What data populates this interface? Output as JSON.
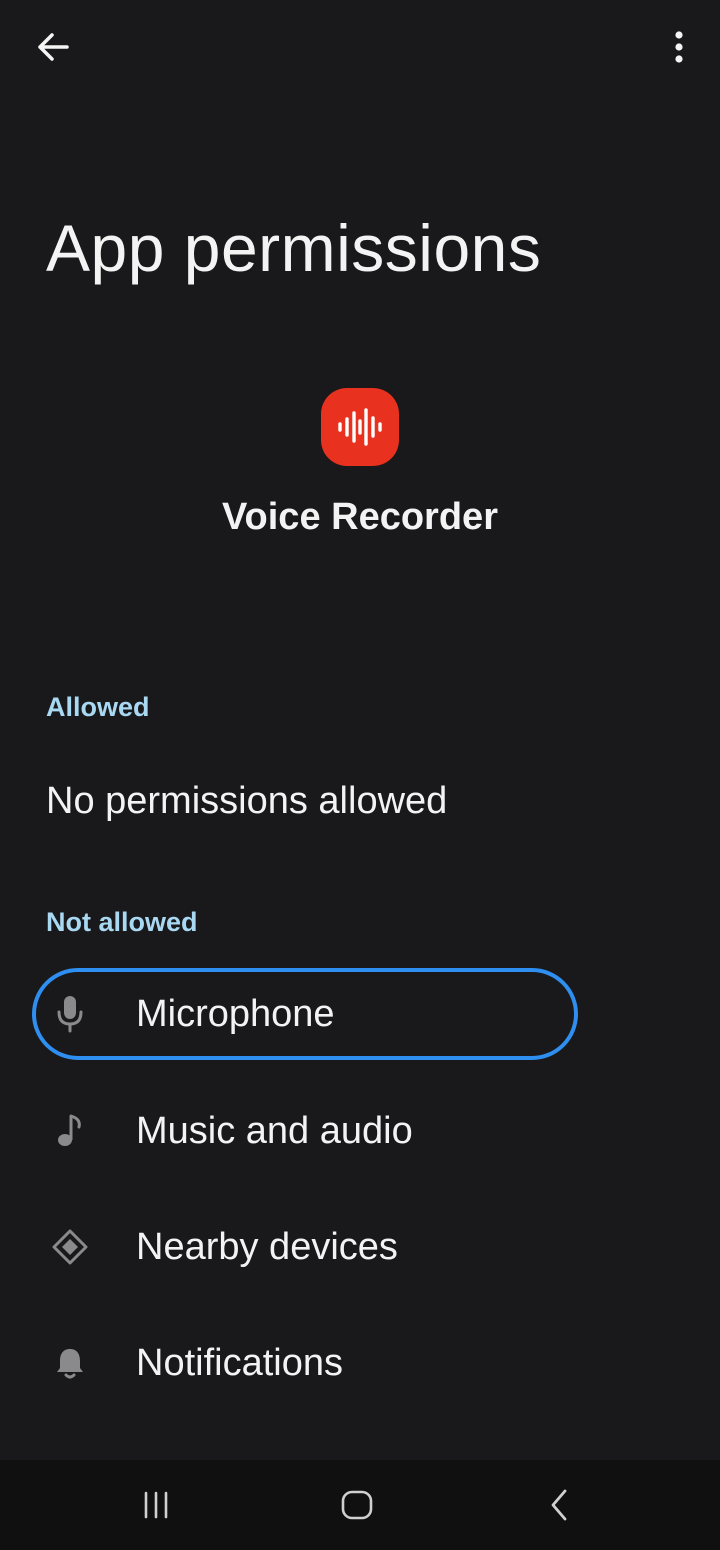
{
  "header": {
    "back_icon": "arrow-left-icon",
    "more_icon": "more-vert-icon"
  },
  "page": {
    "title": "App permissions"
  },
  "app": {
    "name": "Voice Recorder",
    "icon": "waveform-icon",
    "icon_color": "#e8321f"
  },
  "sections": {
    "allowed": {
      "header": "Allowed",
      "empty_text": "No permissions allowed"
    },
    "not_allowed": {
      "header": "Not allowed",
      "items": [
        {
          "label": "Microphone",
          "icon": "microphone-icon",
          "focused": true
        },
        {
          "label": "Music and audio",
          "icon": "music-note-icon",
          "focused": false
        },
        {
          "label": "Nearby devices",
          "icon": "nearby-devices-icon",
          "focused": false
        },
        {
          "label": "Notifications",
          "icon": "bell-icon",
          "focused": false
        }
      ]
    }
  },
  "colors": {
    "background": "#19191b",
    "section_header": "#a9d8f3",
    "focus_ring": "#2e8ff0",
    "nav_bar": "#101011"
  },
  "nav_bar": {
    "recents_icon": "recents-icon",
    "home_icon": "home-icon",
    "back_icon": "back-chevron-icon"
  }
}
